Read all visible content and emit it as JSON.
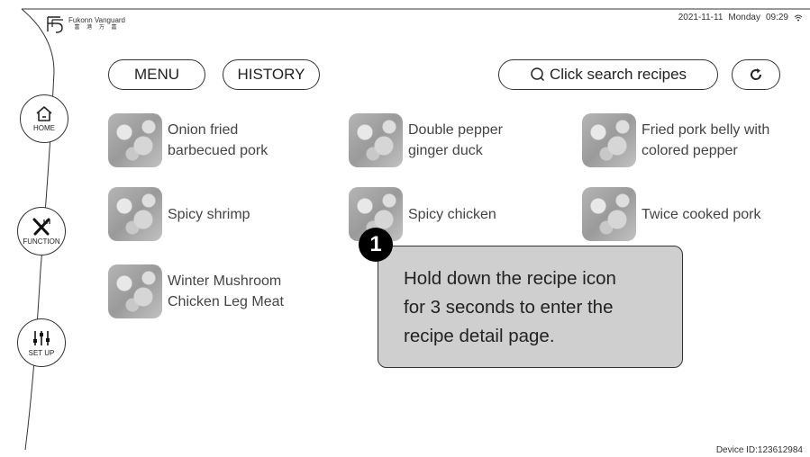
{
  "brand": {
    "name": "Fukonn Vanguard",
    "sub": "富 港 万 嘉"
  },
  "status": {
    "date": "2021-11-11",
    "weekday": "Monday",
    "time": "09:29",
    "wifi_icon": "wifi-icon"
  },
  "device_id": "Device ID:123612984",
  "toolbar": {
    "menu": "MENU",
    "history": "HISTORY",
    "search": "Click search recipes",
    "refresh_icon": "refresh-icon"
  },
  "sidebar": [
    {
      "label": "HOME",
      "icon": "home-icon"
    },
    {
      "label": "FUNCTION",
      "icon": "utensils-icon"
    },
    {
      "label": "SET UP",
      "icon": "sliders-icon"
    }
  ],
  "recipes": [
    {
      "line1": "Onion fried",
      "line2": "barbecued pork"
    },
    {
      "line1": "Double pepper",
      "line2": "ginger duck"
    },
    {
      "line1": "Fried pork belly with",
      "line2": "colored pepper"
    },
    {
      "line1": "Spicy shrimp",
      "line2": ""
    },
    {
      "line1": "Spicy chicken",
      "line2": ""
    },
    {
      "line1": "Twice cooked pork",
      "line2": ""
    },
    {
      "line1": "Winter Mushroom",
      "line2": "Chicken Leg Meat"
    }
  ],
  "tip": {
    "badge": "1",
    "line1": "Hold down the recipe icon",
    "line2": "for 3 seconds to enter the",
    "line3": "recipe detail page."
  }
}
